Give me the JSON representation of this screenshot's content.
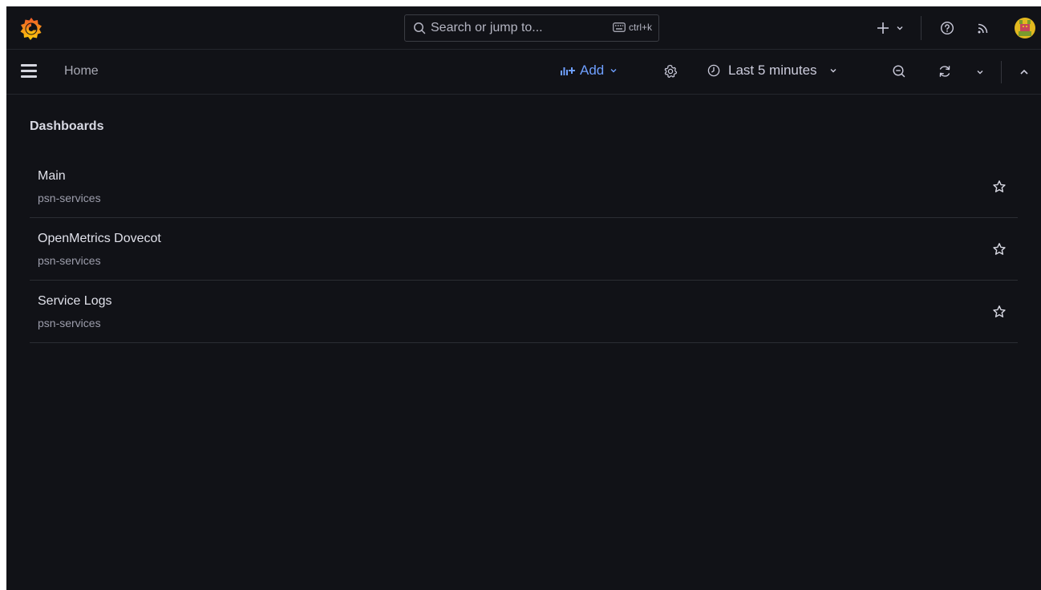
{
  "topbar": {
    "logo": "grafana-logo",
    "search": {
      "placeholder": "Search or jump to...",
      "shortcut": "ctrl+k"
    },
    "icons": [
      "plus-icon",
      "chevron-down-icon",
      "help-icon",
      "rss-icon",
      "user-avatar"
    ]
  },
  "navbar": {
    "breadcrumb": "Home",
    "add_label": "Add",
    "time_range": "Last 5 minutes"
  },
  "content": {
    "section_title": "Dashboards",
    "dashboards": [
      {
        "name": "Main",
        "folder": "psn-services"
      },
      {
        "name": "OpenMetrics Dovecot",
        "folder": "psn-services"
      },
      {
        "name": "Service Logs",
        "folder": "psn-services"
      }
    ]
  },
  "colors": {
    "background": "#111217",
    "accent": "#6e9fff",
    "logo_orange": "#f46800",
    "logo_yellow": "#fbca0a"
  }
}
